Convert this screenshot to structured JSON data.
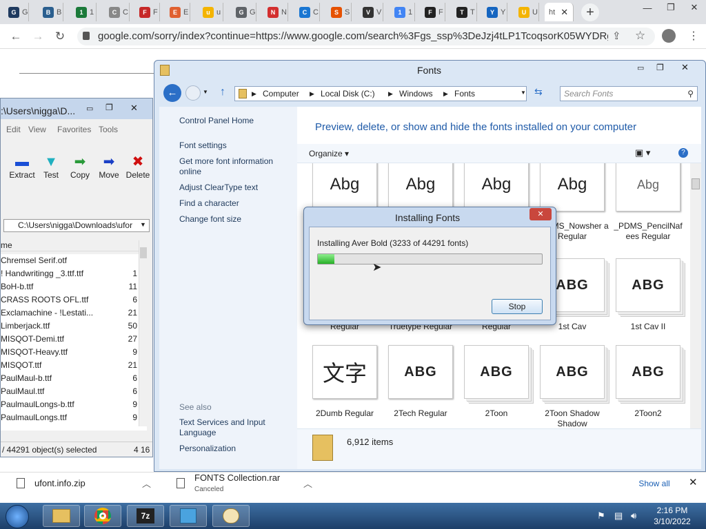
{
  "browser": {
    "tabs": [
      {
        "label": "G",
        "color": "#1f3a5f"
      },
      {
        "label": "B",
        "color": "#2b5f8f"
      },
      {
        "label": "1",
        "color": "#1b7a3a"
      },
      {
        "label": "C",
        "color": "#888888"
      },
      {
        "label": "F",
        "color": "#c62828"
      },
      {
        "label": "E",
        "color": "#e06030"
      },
      {
        "label": "u",
        "color": "#f4b400"
      },
      {
        "label": "G",
        "color": "#5f6368"
      },
      {
        "label": "N",
        "color": "#d32f2f"
      },
      {
        "label": "C",
        "color": "#1976d2"
      },
      {
        "label": "S",
        "color": "#e65100"
      },
      {
        "label": "V",
        "color": "#333333"
      },
      {
        "label": "1",
        "color": "#4285f4"
      },
      {
        "label": "F",
        "color": "#222222"
      },
      {
        "label": "T",
        "color": "#222222"
      },
      {
        "label": "Y",
        "color": "#1565c0"
      },
      {
        "label": "U",
        "color": "#f4b400"
      }
    ],
    "active_tab_label": "ht",
    "url": "google.com/sorry/index?continue=https://www.google.com/search%3Fgs_ssp%3DeJzj4tLP1TcoqsorK05WYDRgdGDw..."
  },
  "zip": {
    "title": ":\\Users\\nigga\\D...",
    "menu": [
      "Edit",
      "View",
      "Favorites",
      "Tools"
    ],
    "tools": [
      {
        "label": "Extract",
        "glyph": "▬",
        "color": "#1a4fd6"
      },
      {
        "label": "Test",
        "glyph": "▼",
        "color": "#20b0c0"
      },
      {
        "label": "Copy",
        "glyph": "➡",
        "color": "#2a9a3a"
      },
      {
        "label": "Move",
        "glyph": "➡",
        "color": "#1a3fc6"
      },
      {
        "label": "Delete",
        "glyph": "✖",
        "color": "#d01010"
      }
    ],
    "path": "C:\\Users\\nigga\\Downloads\\ufor",
    "column_header": "me",
    "files": [
      {
        "name": "Chremsel Serif.otf",
        "size": ""
      },
      {
        "name": "! Handwritingg _3.ttf.ttf",
        "size": "1"
      },
      {
        "name": "BoH-b.ttf",
        "size": "11"
      },
      {
        "name": "CRASS ROOTS OFL.ttf",
        "size": "6"
      },
      {
        "name": "Exclamachine - !Lestati...",
        "size": "21"
      },
      {
        "name": "Limberjack.ttf",
        "size": "50"
      },
      {
        "name": "MISQOT-Demi.ttf",
        "size": "27"
      },
      {
        "name": "MISQOT-Heavy.ttf",
        "size": "9"
      },
      {
        "name": "MISQOT.ttf",
        "size": "21"
      },
      {
        "name": "PaulMaul-b.ttf",
        "size": "6"
      },
      {
        "name": "PaulMaul.ttf",
        "size": "6"
      },
      {
        "name": "PaulmaulLongs-b.ttf",
        "size": "9"
      },
      {
        "name": "PaulmaulLongs.ttf",
        "size": "9"
      }
    ],
    "status_left": "/ 44291 object(s) selected",
    "status_right": "4 16"
  },
  "fonts": {
    "title": "Fonts",
    "breadcrumbs": [
      "Computer",
      "Local Disk (C:)",
      "Windows",
      "Fonts"
    ],
    "search_placeholder": "Search Fonts",
    "left_links": [
      "Control Panel Home",
      "Font settings",
      "Get more font information online",
      "Adjust ClearType text",
      "Find a character",
      "Change font size"
    ],
    "see_also_label": "See also",
    "see_also": [
      "Text Services and Input Language",
      "Personalization"
    ],
    "heading": "Preview, delete, or show and hide the fonts installed on your computer",
    "organize": "Organize",
    "row1": [
      {
        "name": "",
        "sample": "Abg",
        "stack": false
      },
      {
        "name": "",
        "sample": "Abg",
        "stack": false
      },
      {
        "name": "",
        "sample": "Abg",
        "stack": false
      },
      {
        "name": "_PDMS_Nowsher a Regular",
        "sample": "Abg",
        "stack": false
      },
      {
        "name": "_PDMS_PencilNaf ees Regular",
        "sample": "Abg",
        "stack": false
      }
    ],
    "row2": [
      {
        "name": "Regular",
        "sample": "",
        "stack": false
      },
      {
        "name": "Truetype Regular",
        "sample": "",
        "stack": false
      },
      {
        "name": "Regular",
        "sample": "",
        "stack": false
      },
      {
        "name": "1st Cav",
        "sample": "ABG",
        "stack": true
      },
      {
        "name": "1st Cav II",
        "sample": "ABG",
        "stack": true
      }
    ],
    "row3": [
      {
        "name": "2Dumb Regular",
        "sample": "文字",
        "stack": false
      },
      {
        "name": "2Tech Regular",
        "sample": "ABG",
        "stack": false
      },
      {
        "name": "2Toon",
        "sample": "ABG",
        "stack": true
      },
      {
        "name": "2Toon Shadow Shadow",
        "sample": "ABG",
        "stack": true
      },
      {
        "name": "2Toon2",
        "sample": "ABG",
        "stack": true
      }
    ],
    "item_count": "6,912 items"
  },
  "dialog": {
    "title": "Installing Fonts",
    "status": "Installing Aver Bold (3233 of 44291 fonts)",
    "progress_fraction": 0.073,
    "stop_label": "Stop"
  },
  "downloads": [
    {
      "name": "ufont.info.zip",
      "sub": ""
    },
    {
      "name": "FONTS Collection.rar",
      "sub": "Canceled"
    }
  ],
  "show_all": "Show all",
  "clock": {
    "time": "2:16 PM",
    "date": "3/10/2022"
  }
}
